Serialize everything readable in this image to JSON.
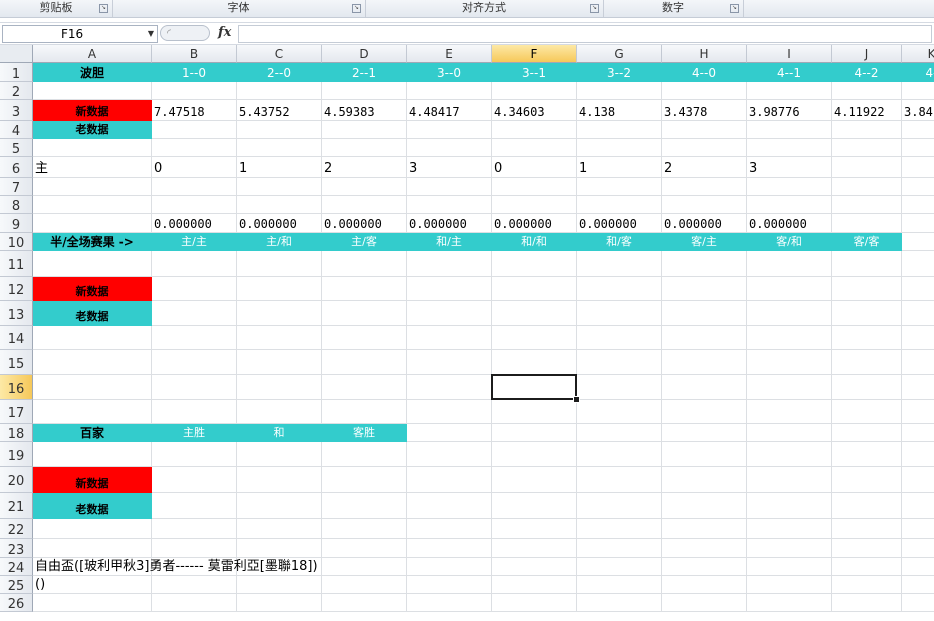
{
  "ribbon": {
    "groups": [
      "剪贴板",
      "字体",
      "对齐方式",
      "数字"
    ]
  },
  "formula_bar": {
    "name_box": "F16",
    "fx_label": "fx",
    "formula": ""
  },
  "colors": {
    "teal": "#33cccc",
    "red": "#ff0000",
    "header_selected": "#f6c85a"
  },
  "active_cell": "F16",
  "columns": [
    "A",
    "B",
    "C",
    "D",
    "E",
    "F",
    "G",
    "H",
    "I",
    "J",
    "K"
  ],
  "rows": [
    "1",
    "2",
    "3",
    "4",
    "5",
    "6",
    "7",
    "8",
    "9",
    "10",
    "11",
    "12",
    "13",
    "14",
    "15",
    "16",
    "17",
    "18",
    "19",
    "20",
    "21",
    "22",
    "23",
    "24",
    "25",
    "26"
  ],
  "cells": {
    "A1": "波胆",
    "B1": "1--0",
    "C1": "2--0",
    "D1": "2--1",
    "E1": "3--0",
    "F1": "3--1",
    "G1": "3--2",
    "H1": "4--0",
    "I1": "4--1",
    "J1": "4--2",
    "K1": "4-",
    "A3": "新数据",
    "B3": "7.47518",
    "C3": "5.43752",
    "D3": "4.59383",
    "E3": "4.48417",
    "F3": "4.34603",
    "G3": "4.138",
    "H3": "3.4378",
    "I3": "3.98776",
    "J3": "4.11922",
    "K3": "3.84",
    "A4": "老数据",
    "A6": "主",
    "B6": "0",
    "C6": "1",
    "D6": "2",
    "E6": "3",
    "F6": "0",
    "G6": "1",
    "H6": "2",
    "I6": "3",
    "B9": "0.000000",
    "C9": "0.000000",
    "D9": "0.000000",
    "E9": "0.000000",
    "F9": "0.000000",
    "G9": "0.000000",
    "H9": "0.000000",
    "I9": "0.000000",
    "A10": "半/全场赛果 ->",
    "B10": "主/主",
    "C10": "主/和",
    "D10": "主/客",
    "E10": "和/主",
    "F10": "和/和",
    "G10": "和/客",
    "H10": "客/主",
    "I10": "客/和",
    "J10": "客/客",
    "A12": "新数据",
    "A13": "老数据",
    "A18": "百家",
    "B18": "主胜",
    "C18": "和",
    "D18": "客胜",
    "A20": "新数据",
    "A21": "老数据",
    "A24": "自由盃([玻利甲秋3]勇者------ 莫雷利亞[墨聯18])",
    "A25": "()"
  }
}
